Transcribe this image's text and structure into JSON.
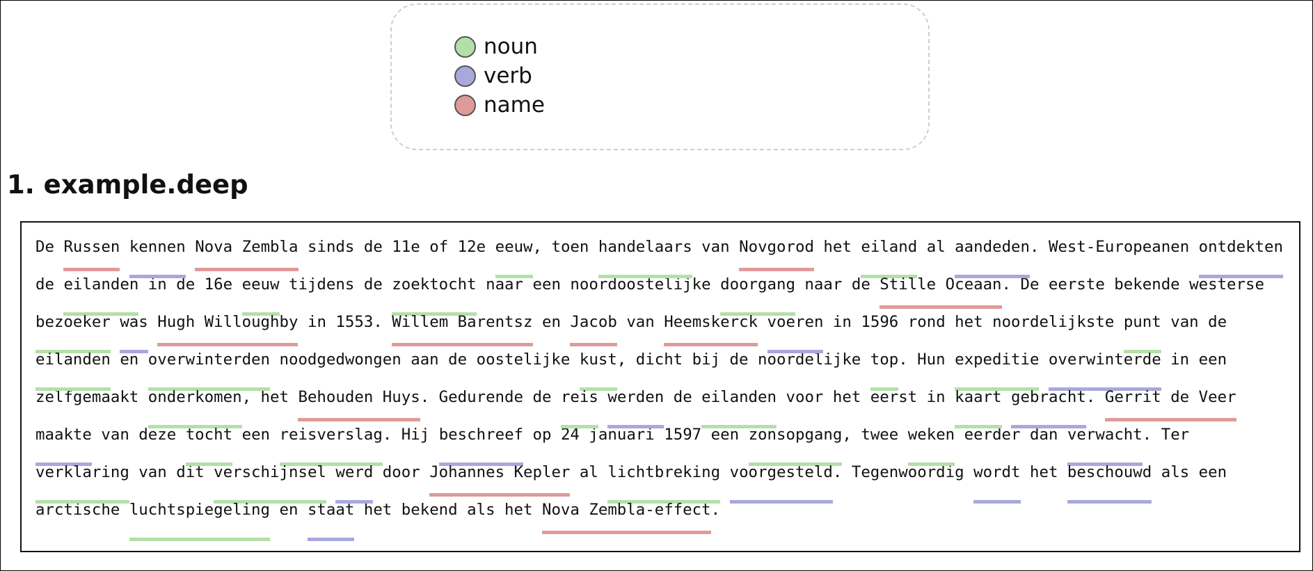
{
  "legend": {
    "items": [
      {
        "label": "noun",
        "color": "#b3e0a8"
      },
      {
        "label": "verb",
        "color": "#a8a8dd"
      },
      {
        "label": "name",
        "color": "#e09a9a"
      }
    ]
  },
  "section": {
    "title": "1. example.deep"
  },
  "paragraph": [
    {
      "text": "De "
    },
    {
      "text": "Russen",
      "tag": "name"
    },
    {
      "text": " "
    },
    {
      "text": "kennen",
      "tag": "verb"
    },
    {
      "text": " "
    },
    {
      "text": "Nova Zembla",
      "tag": "name"
    },
    {
      "text": " sinds de 11e of 12e "
    },
    {
      "text": "eeuw",
      "tag": "noun"
    },
    {
      "text": ", toen "
    },
    {
      "text": "handelaars",
      "tag": "noun"
    },
    {
      "text": " van "
    },
    {
      "text": "Novgorod",
      "tag": "name"
    },
    {
      "text": " het "
    },
    {
      "text": "eiland",
      "tag": "noun"
    },
    {
      "text": " al "
    },
    {
      "text": "aandeden",
      "tag": "verb"
    },
    {
      "text": ". West-Europeanen "
    },
    {
      "text": "ontdekten",
      "tag": "verb"
    },
    {
      "text": " de "
    },
    {
      "text": "eilanden",
      "tag": "noun"
    },
    {
      "text": " in de 16e "
    },
    {
      "text": "eeuw",
      "tag": "noun"
    },
    {
      "text": " tijdens de "
    },
    {
      "text": "zoektocht",
      "tag": "noun"
    },
    {
      "text": " naar een noordoostelijke "
    },
    {
      "text": "doorgang",
      "tag": "noun"
    },
    {
      "text": " naar de "
    },
    {
      "text": "Stille Oceaan",
      "tag": "name"
    },
    {
      "text": ". De eerste bekende westerse "
    },
    {
      "text": "bezoeker",
      "tag": "noun"
    },
    {
      "text": " "
    },
    {
      "text": "was",
      "tag": "verb"
    },
    {
      "text": " "
    },
    {
      "text": "Hugh Willoughby",
      "tag": "name"
    },
    {
      "text": " in 1553. "
    },
    {
      "text": "Willem Barentsz",
      "tag": "name"
    },
    {
      "text": " en "
    },
    {
      "text": "Jacob",
      "tag": "name"
    },
    {
      "text": " van "
    },
    {
      "text": "Heemskerck",
      "tag": "name"
    },
    {
      "text": " "
    },
    {
      "text": "voeren",
      "tag": "verb"
    },
    {
      "text": " in 1596 rond het noordelijkste "
    },
    {
      "text": "punt",
      "tag": "noun"
    },
    {
      "text": " van de "
    },
    {
      "text": "eilanden",
      "tag": "noun"
    },
    {
      "text": " en "
    },
    {
      "text": "overwinterden",
      "tag": "noun"
    },
    {
      "text": " noodgedwongen aan de oostelijke "
    },
    {
      "text": "kust",
      "tag": "noun"
    },
    {
      "text": ", dicht bij de noordelijke "
    },
    {
      "text": "top",
      "tag": "noun"
    },
    {
      "text": ". Hun "
    },
    {
      "text": "expeditie",
      "tag": "noun"
    },
    {
      "text": " "
    },
    {
      "text": "overwinterde",
      "tag": "verb"
    },
    {
      "text": " in een zelfgemaakt "
    },
    {
      "text": "onderkomen",
      "tag": "noun"
    },
    {
      "text": ", het "
    },
    {
      "text": "Behouden Huys",
      "tag": "name"
    },
    {
      "text": ". Gedurende de "
    },
    {
      "text": "reis",
      "tag": "noun"
    },
    {
      "text": " "
    },
    {
      "text": "werden",
      "tag": "verb"
    },
    {
      "text": " de "
    },
    {
      "text": "eilanden",
      "tag": "noun"
    },
    {
      "text": " voor het eerst in "
    },
    {
      "text": "kaart",
      "tag": "noun"
    },
    {
      "text": " "
    },
    {
      "text": "gebracht",
      "tag": "verb"
    },
    {
      "text": ". "
    },
    {
      "text": "Gerrit de Veer",
      "tag": "name"
    },
    {
      "text": " "
    },
    {
      "text": "maakte",
      "tag": "verb"
    },
    {
      "text": " van deze "
    },
    {
      "text": "tocht",
      "tag": "noun"
    },
    {
      "text": " een "
    },
    {
      "text": "reisverslag",
      "tag": "noun"
    },
    {
      "text": ". Hij "
    },
    {
      "text": "beschreef",
      "tag": "verb"
    },
    {
      "text": " op 24 januari 1597 een "
    },
    {
      "text": "zonsopgang",
      "tag": "noun"
    },
    {
      "text": ", twee "
    },
    {
      "text": "weken",
      "tag": "noun"
    },
    {
      "text": " eerder dan "
    },
    {
      "text": "verwacht",
      "tag": "verb"
    },
    {
      "text": ". Ter "
    },
    {
      "text": "verklaring",
      "tag": "noun"
    },
    {
      "text": " van dit "
    },
    {
      "text": "verschijnsel",
      "tag": "noun"
    },
    {
      "text": " "
    },
    {
      "text": "werd",
      "tag": "verb"
    },
    {
      "text": " door "
    },
    {
      "text": "Johannes Kepler",
      "tag": "name"
    },
    {
      "text": " al "
    },
    {
      "text": "lichtbreking",
      "tag": "noun"
    },
    {
      "text": " "
    },
    {
      "text": "voorgesteld",
      "tag": "verb"
    },
    {
      "text": ". Tegenwoordig "
    },
    {
      "text": "wordt",
      "tag": "verb"
    },
    {
      "text": " het "
    },
    {
      "text": "beschouwd",
      "tag": "verb"
    },
    {
      "text": " als een arctische "
    },
    {
      "text": "luchtspiegeling",
      "tag": "noun"
    },
    {
      "text": " en "
    },
    {
      "text": "staat",
      "tag": "verb"
    },
    {
      "text": " het bekend als het "
    },
    {
      "text": "Nova Zembla-effect",
      "tag": "name"
    },
    {
      "text": "."
    }
  ]
}
